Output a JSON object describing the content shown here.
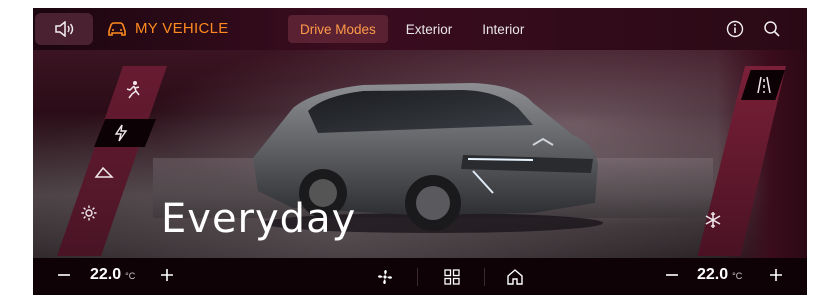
{
  "topbar": {
    "brand_label": "MY VEHICLE",
    "tabs": [
      {
        "label": "Drive Modes",
        "active": true
      },
      {
        "label": "Exterior",
        "active": false
      },
      {
        "label": "Interior",
        "active": false
      }
    ]
  },
  "drive_mode": {
    "current": "Everyday",
    "left_modes": [
      {
        "icon": "off-road-person-icon"
      },
      {
        "icon": "lightning-icon",
        "active": true
      },
      {
        "icon": "hill-icon"
      },
      {
        "icon": "settings-icon"
      }
    ],
    "right_modes": [
      {
        "icon": "road-lanes-icon",
        "active": true
      },
      {
        "icon": "snowflake-icon"
      }
    ]
  },
  "climate": {
    "left_temp": "22.0",
    "right_temp": "22.0",
    "unit": "°C"
  },
  "colors": {
    "accent": "#ff8a1f",
    "background": "#120309",
    "rail": "#6b1c33"
  }
}
